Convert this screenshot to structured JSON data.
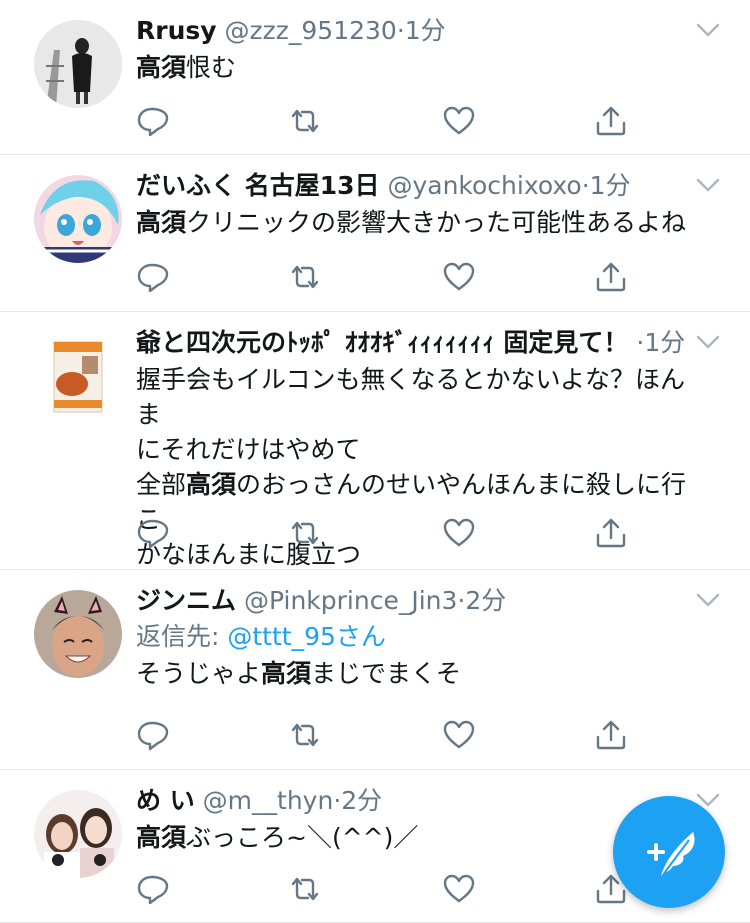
{
  "tweets": [
    {
      "name": "Rrusy",
      "handle": "@zzz_951230",
      "time": "1分",
      "text_parts": [
        {
          "t": "高須",
          "b": true
        },
        {
          "t": "恨む",
          "b": false
        }
      ],
      "avatar": "avatar-person-black-coat"
    },
    {
      "name": "だいふく 名古屋13日",
      "handle": "@yankochixoxo",
      "time": "1分",
      "text_parts": [
        {
          "t": "高須",
          "b": true
        },
        {
          "t": "クリニックの影響大きかった可能性あるよね",
          "b": false
        }
      ],
      "avatar": "avatar-anime-girl"
    },
    {
      "name": "爺と四次元のﾄｯﾎﾟ ｵｵｵｷﾞｨｨｨｨｨｨｨ 固定見て！",
      "handle": "",
      "time": "1分",
      "text_lines": [
        [
          {
            "t": "握手会もイルコンも無くなるとかないよな？ほんま",
            "b": false
          }
        ],
        [
          {
            "t": "にそれだけはやめて",
            "b": false
          }
        ],
        [
          {
            "t": "全部",
            "b": false
          },
          {
            "t": "高須",
            "b": true
          },
          {
            "t": "のおっさんのせいやんほんまに殺しに行こ",
            "b": false
          }
        ],
        [
          {
            "t": "かなほんまに腹立つ",
            "b": false
          }
        ]
      ],
      "avatar": "avatar-snack-package"
    },
    {
      "name": "ジンニム",
      "handle": "@Pinkprince_Jin3",
      "time": "2分",
      "reply_label": "返信先: ",
      "reply_mention": "@tttt_95さん",
      "text_parts": [
        {
          "t": "そうじゃよ",
          "b": false
        },
        {
          "t": "高須",
          "b": true
        },
        {
          "t": "まじでまくそ",
          "b": false
        }
      ],
      "avatar": "avatar-man-cat-ears"
    },
    {
      "name": "め い",
      "handle": "@m__thyn",
      "time": "2分",
      "text_parts": [
        {
          "t": "高須",
          "b": true
        },
        {
          "t": "ぶっころ~＼(^^)／",
          "b": false
        }
      ],
      "avatar": "avatar-two-girls"
    }
  ],
  "dot": "·",
  "icons": {
    "reply": "reply-icon",
    "retweet": "retweet-icon",
    "like": "heart-icon",
    "share": "share-icon",
    "caret": "chevron-down-icon",
    "compose": "compose-tweet-icon"
  },
  "colors": {
    "accent": "#1da1f2",
    "icon": "#657786",
    "caret": "#aab8c2",
    "divider": "#e1e8ed"
  }
}
